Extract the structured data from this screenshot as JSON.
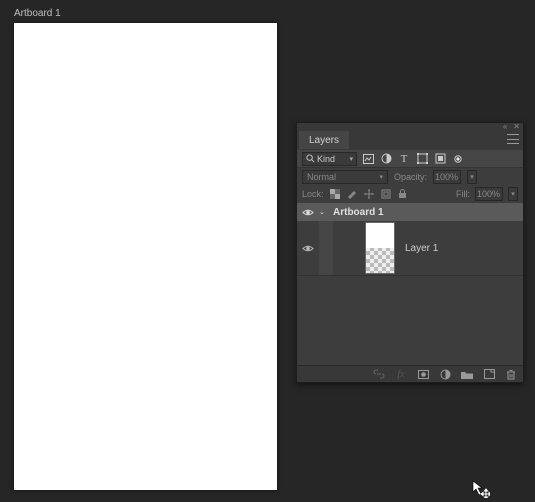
{
  "canvas": {
    "artboard_label": "Artboard 1"
  },
  "panel": {
    "title": "Layers",
    "filter": {
      "kind_label": "Kind"
    },
    "blend": {
      "mode": "Normal",
      "opacity_label": "Opacity:",
      "opacity_value": "100%"
    },
    "lock": {
      "label": "Lock:",
      "fill_label": "Fill:",
      "fill_value": "100%"
    },
    "tree": {
      "artboard_name": "Artboard 1",
      "layers": [
        {
          "name": "Layer 1"
        }
      ]
    }
  }
}
